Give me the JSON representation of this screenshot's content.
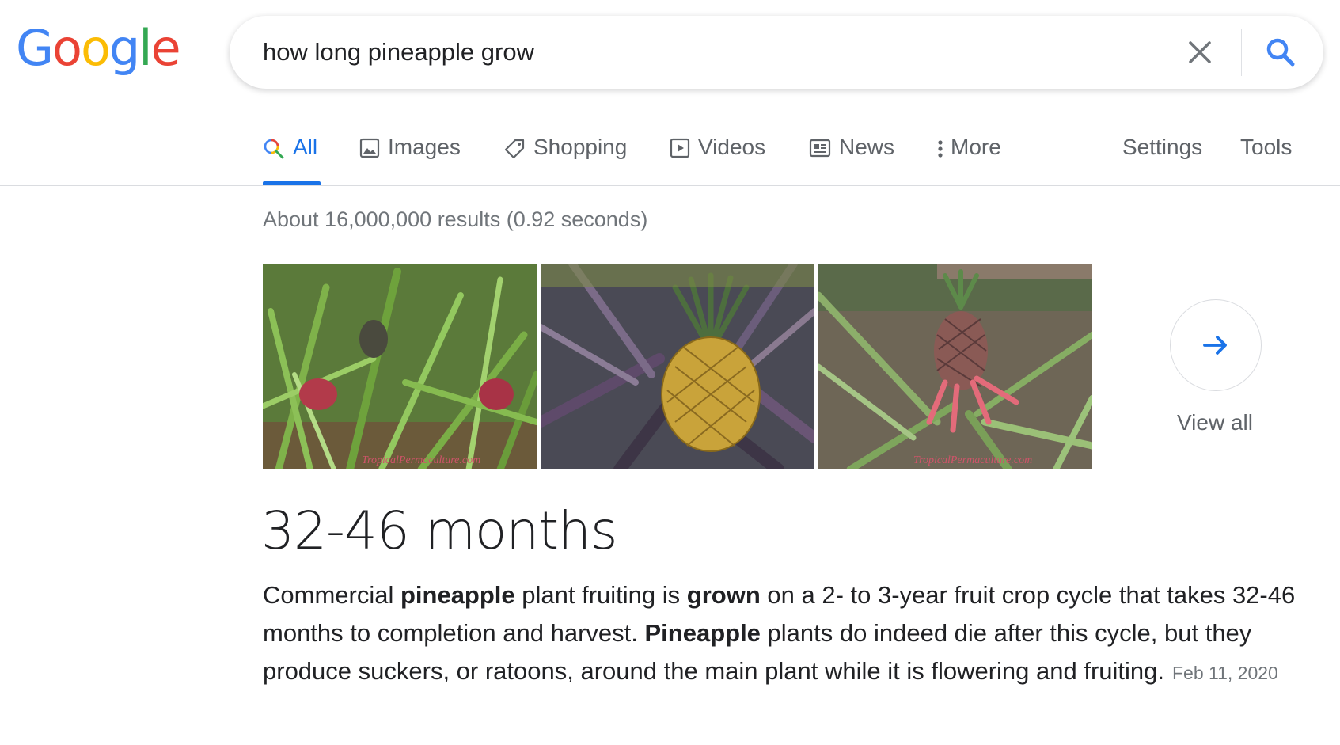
{
  "logo": {
    "text": "Google",
    "letters": [
      {
        "ch": "G",
        "color": "#4285F4"
      },
      {
        "ch": "o",
        "color": "#EA4335"
      },
      {
        "ch": "o",
        "color": "#FBBC05"
      },
      {
        "ch": "g",
        "color": "#4285F4"
      },
      {
        "ch": "l",
        "color": "#34A853"
      },
      {
        "ch": "e",
        "color": "#EA4335"
      }
    ]
  },
  "search": {
    "query": "how long pineapple grow"
  },
  "tabs": [
    {
      "label": "All",
      "icon": "search-icon",
      "active": true
    },
    {
      "label": "Images",
      "icon": "image-icon"
    },
    {
      "label": "Shopping",
      "icon": "tag-icon"
    },
    {
      "label": "Videos",
      "icon": "play-icon"
    },
    {
      "label": "News",
      "icon": "newspaper-icon"
    },
    {
      "label": "More",
      "icon": "more-vert-icon"
    },
    {
      "label": "Settings"
    },
    {
      "label": "Tools"
    }
  ],
  "results": {
    "stats": "About 16,000,000 results (0.92 seconds)"
  },
  "images": {
    "view_all_label": "View all",
    "watermarks": [
      "TropicalPermaculture.com",
      "TropicalPermaculture.com"
    ]
  },
  "featured": {
    "answer": "32-46 months",
    "snippet": {
      "s1": "Commercial ",
      "b1": "pineapple",
      "s2": " plant fruiting is ",
      "b2": "grown",
      "s3": " on a 2- to 3-year fruit crop cycle that takes 32-46 months to completion and harvest. ",
      "b3": "Pineapple",
      "s4": " plants do indeed die after this cycle, but they produce suckers, or ratoons, around the main plant while it is flowering and fruiting."
    },
    "date": "Feb 11, 2020"
  },
  "colors": {
    "accent": "#1a73e8",
    "text": "#202124",
    "muted": "#70757a"
  }
}
